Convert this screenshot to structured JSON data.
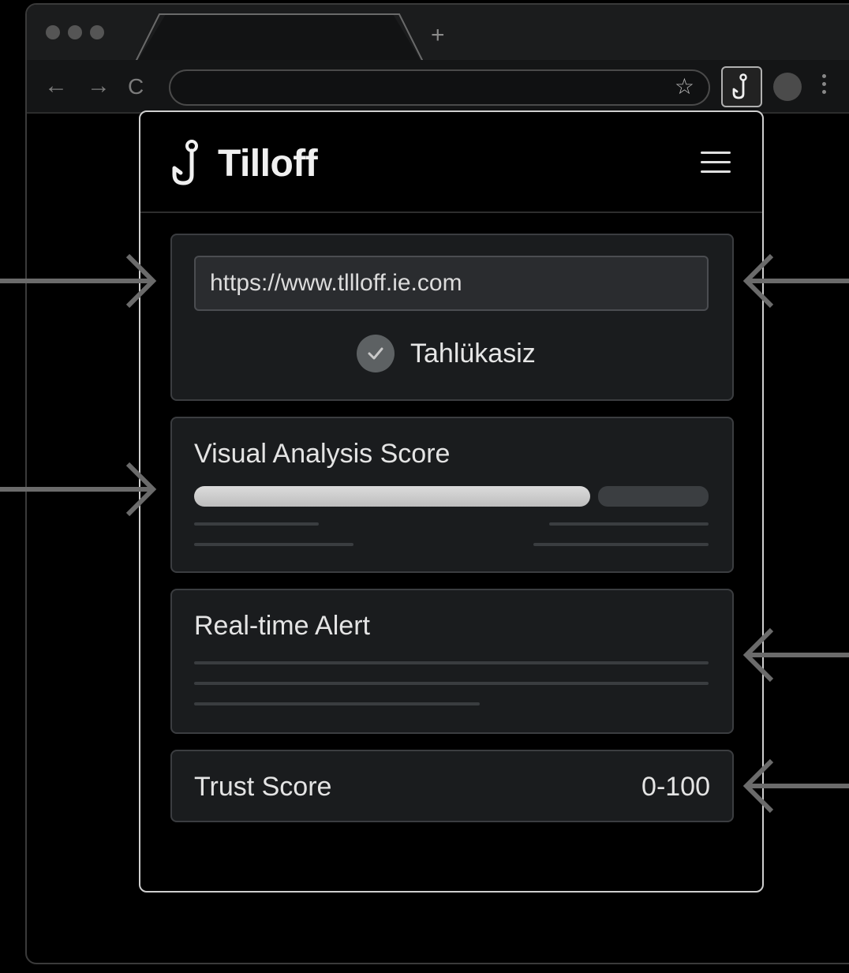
{
  "browser": {
    "new_tab_symbol": "+",
    "nav": {
      "back": "←",
      "forward": "→",
      "reload": "C"
    },
    "bookmark_symbol": "☆"
  },
  "extension": {
    "brand_name": "Tilloff",
    "url_field": {
      "value": "https://www.tllloff.ie.com"
    },
    "status_label": "Tahlükasiz",
    "visual_analysis": {
      "title": "Visual Analysis Score",
      "score_fraction": 0.77
    },
    "realtime_alert": {
      "title": "Real-time Alert"
    },
    "trust_score": {
      "label": "Trust Score",
      "range": "0-100"
    }
  },
  "colors": {
    "background": "#000000",
    "card": "#1a1c1e",
    "accent": "#dcdcdc",
    "status_icon": "#5d6163"
  }
}
